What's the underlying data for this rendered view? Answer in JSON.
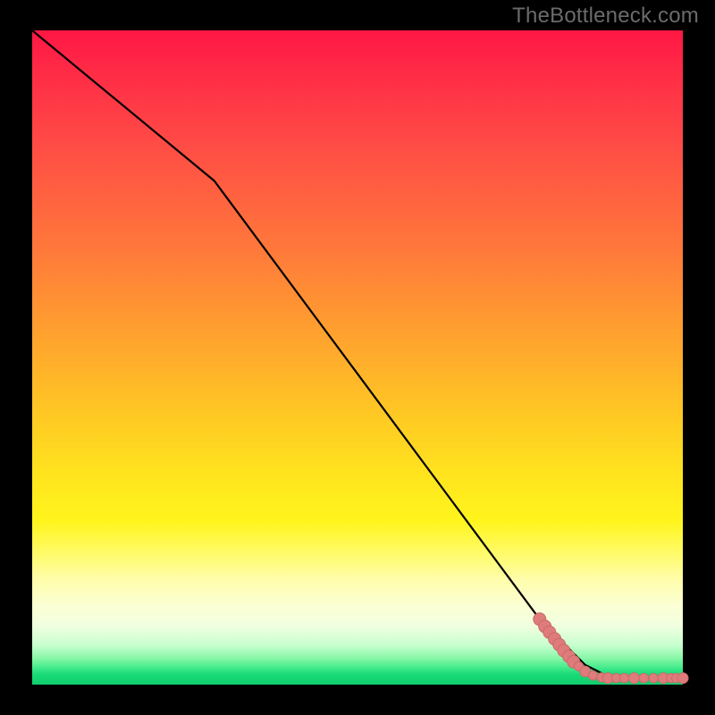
{
  "attribution": "TheBottleneck.com",
  "chart_data": {
    "type": "line",
    "title": "",
    "xlabel": "",
    "ylabel": "",
    "xlim": [
      0,
      100
    ],
    "ylim": [
      0,
      100
    ],
    "axes_visible": false,
    "background": "vertical-gradient red→yellow→green",
    "trend_line": {
      "color": "#000000",
      "points_xy": [
        [
          0,
          100
        ],
        [
          28,
          77
        ],
        [
          78,
          10
        ],
        [
          85,
          3
        ],
        [
          88,
          1.5
        ],
        [
          92,
          1
        ],
        [
          100,
          1
        ]
      ]
    },
    "scatter": {
      "color": "#e07b7b",
      "points_xy": [
        [
          78.0,
          10.0
        ],
        [
          78.8,
          8.9
        ],
        [
          79.5,
          8.0
        ],
        [
          80.3,
          7.0
        ],
        [
          81.0,
          6.1
        ],
        [
          81.7,
          5.2
        ],
        [
          82.5,
          4.3
        ],
        [
          83.2,
          3.5
        ],
        [
          84.0,
          2.8
        ],
        [
          85.0,
          2.0
        ],
        [
          86.2,
          1.4
        ],
        [
          87.5,
          1.1
        ],
        [
          88.5,
          1.0
        ],
        [
          89.8,
          1.0
        ],
        [
          91.0,
          1.0
        ],
        [
          92.5,
          1.0
        ],
        [
          94.0,
          1.0
        ],
        [
          95.5,
          1.0
        ],
        [
          97.0,
          1.0
        ],
        [
          98.2,
          1.0
        ],
        [
          99.0,
          1.0
        ],
        [
          100.0,
          1.0
        ]
      ]
    }
  },
  "colors": {
    "frame": "#000000",
    "attribution_text": "#6b6b6b",
    "point_fill": "#e07b7b"
  }
}
